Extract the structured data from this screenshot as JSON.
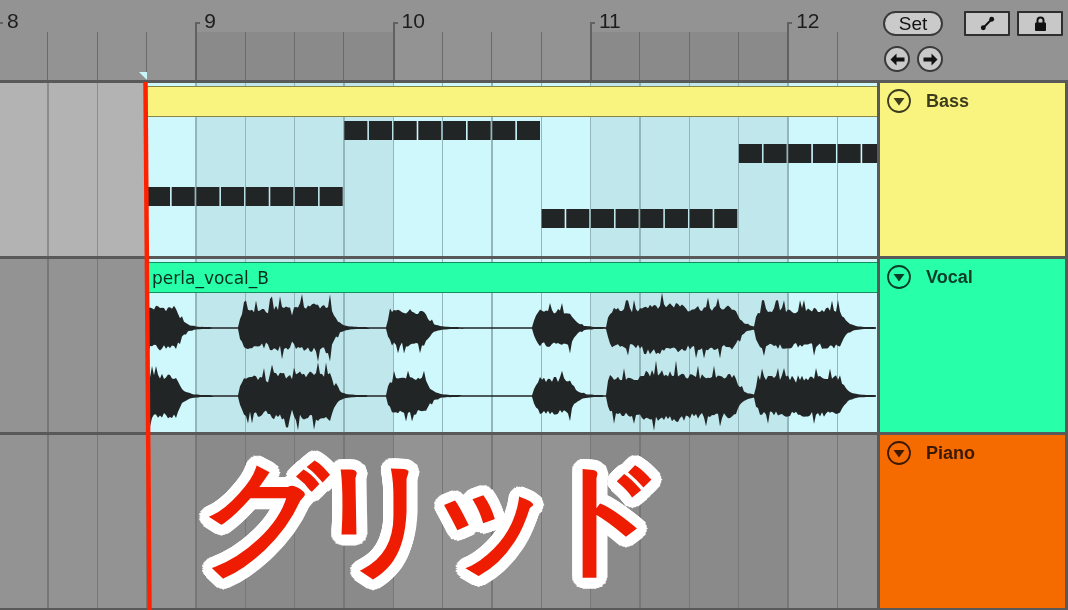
{
  "ruler": {
    "bars": [
      "8",
      "9",
      "10",
      "11",
      "12"
    ]
  },
  "controls": {
    "set_button": {
      "label": "Set"
    }
  },
  "tracks": [
    {
      "name": "Bass",
      "color": "#f9f47f",
      "selected": true,
      "expanded": true,
      "clip": {
        "kind": "midi",
        "selected": true
      }
    },
    {
      "name": "Vocal",
      "color": "#27ffa9",
      "selected": false,
      "expanded": true,
      "clip": {
        "kind": "audio",
        "name": "perla_vocal_B",
        "selected": true
      }
    },
    {
      "name": "Piano",
      "color": "#f56b00",
      "selected": false,
      "expanded": true
    }
  ],
  "caption": {
    "text": "グリッド"
  }
}
